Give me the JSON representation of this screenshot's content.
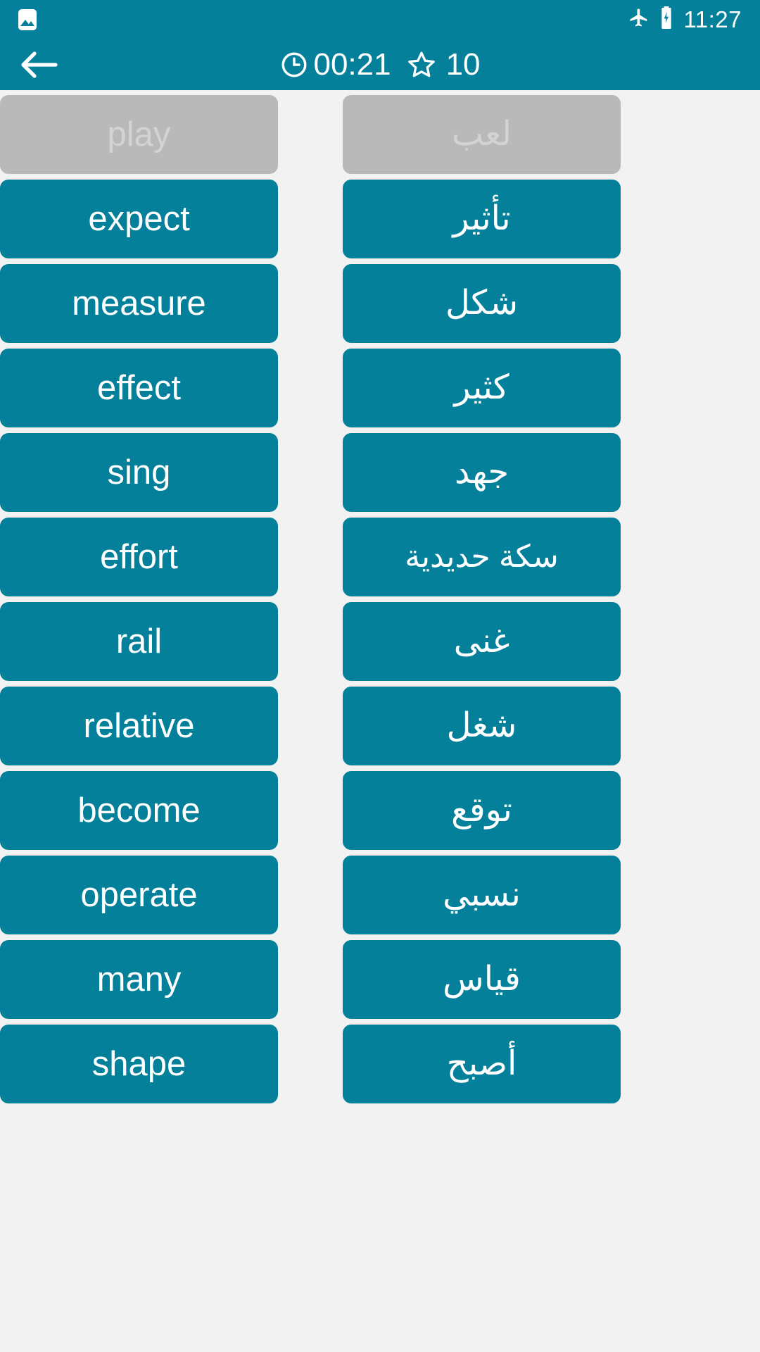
{
  "status_bar": {
    "left_icon": "photo-icon",
    "icons": [
      "airplane-mode-icon",
      "battery-charging-icon"
    ],
    "time": "11:27"
  },
  "toolbar": {
    "back_icon": "back-arrow-icon",
    "timer_icon": "clock-icon",
    "timer": "00:21",
    "star_icon": "star-outline-icon",
    "score": "10"
  },
  "colors": {
    "primary": "#04809a",
    "matched": "#b9b9b9",
    "matched_text": "#d3d3d3",
    "background": "#f2f2f2",
    "card_text": "#ffffff"
  },
  "board": {
    "left_column": [
      {
        "label": "play",
        "state": "matched"
      },
      {
        "label": "expect",
        "state": "active"
      },
      {
        "label": "measure",
        "state": "active"
      },
      {
        "label": "effect",
        "state": "active"
      },
      {
        "label": "sing",
        "state": "active"
      },
      {
        "label": "effort",
        "state": "active"
      },
      {
        "label": "rail",
        "state": "active"
      },
      {
        "label": "relative",
        "state": "active"
      },
      {
        "label": "become",
        "state": "active"
      },
      {
        "label": "operate",
        "state": "active"
      },
      {
        "label": "many",
        "state": "active"
      },
      {
        "label": "shape",
        "state": "active"
      }
    ],
    "right_column": [
      {
        "label": "لعب",
        "state": "matched"
      },
      {
        "label": "تأثير",
        "state": "active"
      },
      {
        "label": "شكل",
        "state": "active"
      },
      {
        "label": "كثير",
        "state": "active"
      },
      {
        "label": "جهد",
        "state": "active"
      },
      {
        "label": "سكة حديدية",
        "state": "active"
      },
      {
        "label": "غنى",
        "state": "active"
      },
      {
        "label": "شغل",
        "state": "active"
      },
      {
        "label": "توقع",
        "state": "active"
      },
      {
        "label": "نسبي",
        "state": "active"
      },
      {
        "label": "قياس",
        "state": "active"
      },
      {
        "label": "أصبح",
        "state": "active"
      }
    ]
  }
}
